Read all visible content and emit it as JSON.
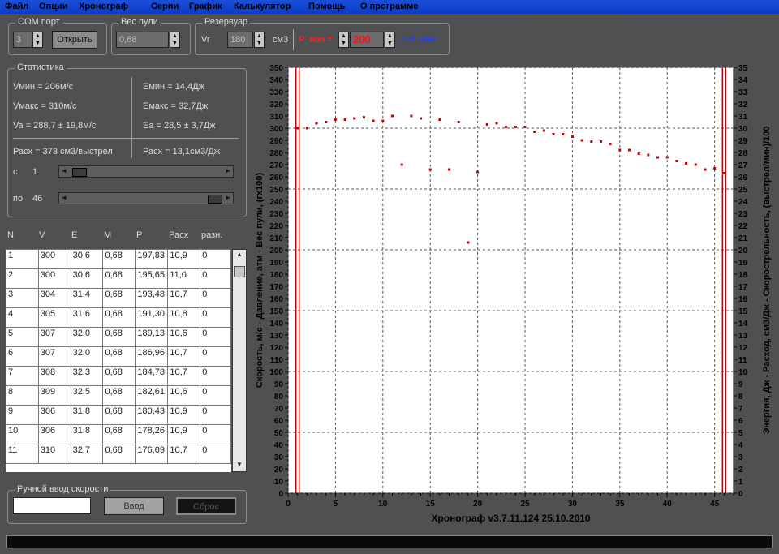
{
  "menu": [
    "Файл",
    "Опции",
    "Хронограф",
    "Серии",
    "График",
    "Калькулятор",
    "Помощь",
    "О программе"
  ],
  "com": {
    "title": "COM порт",
    "value": "3",
    "open_label": "Открыть"
  },
  "weight": {
    "title": "Вес пули",
    "value": "0,68"
  },
  "reservoir": {
    "title": "Резервуар",
    "vr_label": "Vr",
    "vr_value": "180",
    "unit": "см3",
    "p_label": "P_нач =",
    "p_value": "200",
    "p_end_label": "<-P_кон"
  },
  "stats": {
    "title": "Статистика",
    "vmin": "Vмин = 206м/с",
    "vmax": "Vмакс = 310м/с",
    "vavg": "Va = 288,7 ± 19,8м/с",
    "emin": "Eмин = 14,4Дж",
    "emax": "Eмакс = 32,7Дж",
    "eavg": "Ea = 28,5 ± 3,7Дж",
    "rate1": "Расх = 373 см3/выстрел",
    "rate2": "Расх = 13,1см3/Дж",
    "from_label": "с",
    "from_value": "1",
    "to_label": "по",
    "to_value": "46"
  },
  "table": {
    "headers": [
      "N",
      "V",
      "E",
      "M",
      "P",
      "Расх",
      "разн."
    ],
    "rows": [
      [
        "1",
        "300",
        "30,6",
        "0,68",
        "197,83",
        "10,9",
        "0"
      ],
      [
        "2",
        "300",
        "30,6",
        "0,68",
        "195,65",
        "11,0",
        "0"
      ],
      [
        "3",
        "304",
        "31,4",
        "0,68",
        "193,48",
        "10,7",
        "0"
      ],
      [
        "4",
        "305",
        "31,6",
        "0,68",
        "191,30",
        "10,8",
        "0"
      ],
      [
        "5",
        "307",
        "32,0",
        "0,68",
        "189,13",
        "10,6",
        "0"
      ],
      [
        "6",
        "307",
        "32,0",
        "0,68",
        "186,96",
        "10,7",
        "0"
      ],
      [
        "7",
        "308",
        "32,3",
        "0,68",
        "184,78",
        "10,7",
        "0"
      ],
      [
        "8",
        "309",
        "32,5",
        "0,68",
        "182,61",
        "10,6",
        "0"
      ],
      [
        "9",
        "306",
        "31,8",
        "0,68",
        "180,43",
        "10,9",
        "0"
      ],
      [
        "10",
        "306",
        "31,8",
        "0,68",
        "178,26",
        "10,9",
        "0"
      ],
      [
        "11",
        "310",
        "32,7",
        "0,68",
        "176,09",
        "10,7",
        "0"
      ]
    ]
  },
  "manual": {
    "title": "Ручной ввод скорости",
    "enter_label": "Ввод",
    "reset_label": "Сброс"
  },
  "colors": {
    "points": "#cc0000",
    "vlines": "#c00000",
    "grid": "#555555"
  },
  "chart_data": {
    "type": "scatter",
    "ylabel_left": "Скорость, м/с  -  Давление, атм  -  Вес пули,  (гх100)",
    "ylabel_right": "Энергия, Дж  -  Расход, см3/Дж  -  Скорострельность, (выстрел/мин)/100",
    "footer": "Хронограф v3.7.11.124       25.10.2010",
    "xlim": [
      0,
      47
    ],
    "ylim": [
      0,
      350
    ],
    "ylim_right": [
      0,
      35
    ],
    "xticks": [
      0,
      5,
      10,
      15,
      20,
      25,
      30,
      35,
      40,
      45
    ],
    "grid": true,
    "vlines": [
      1,
      46
    ],
    "x": [
      1,
      2,
      3,
      4,
      5,
      6,
      7,
      8,
      9,
      10,
      11,
      12,
      13,
      14,
      15,
      16,
      17,
      18,
      19,
      20,
      21,
      22,
      23,
      24,
      25,
      26,
      27,
      28,
      29,
      30,
      31,
      32,
      33,
      34,
      35,
      36,
      37,
      38,
      39,
      40,
      41,
      42,
      43,
      44,
      45,
      46
    ],
    "y": [
      300,
      300,
      304,
      305,
      307,
      307,
      308,
      309,
      306,
      306,
      310,
      270,
      310,
      308,
      266,
      307,
      266,
      305,
      206,
      264,
      303,
      304,
      301,
      301,
      301,
      297,
      298,
      295,
      295,
      293,
      290,
      289,
      289,
      287,
      282,
      282,
      279,
      278,
      276,
      276,
      273,
      271,
      270,
      266,
      267,
      263
    ]
  }
}
